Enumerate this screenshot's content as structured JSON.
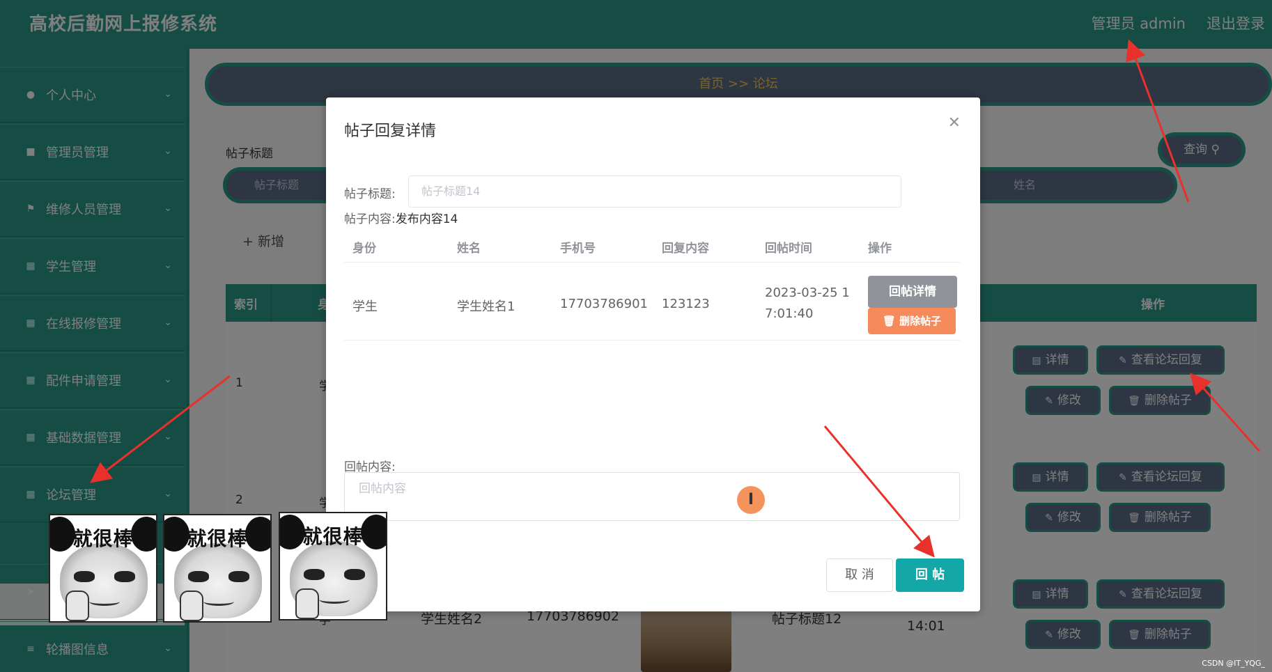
{
  "app": {
    "title": "高校后勤网上报修系统",
    "user_label": "管理员 admin",
    "logout_label": "退出登录"
  },
  "sidebar": {
    "items": [
      {
        "label": "个人中心",
        "icon": "user-icon"
      },
      {
        "label": "管理员管理",
        "icon": "chat-icon"
      },
      {
        "label": "维修人员管理",
        "icon": "flag-icon"
      },
      {
        "label": "学生管理",
        "icon": "grid-icon"
      },
      {
        "label": "在线报修管理",
        "icon": "grid-icon"
      },
      {
        "label": "配件申请管理",
        "icon": "grid-icon"
      },
      {
        "label": "基础数据管理",
        "icon": "grid-icon"
      },
      {
        "label": "论坛管理",
        "icon": "grid-icon"
      },
      {
        "label": "",
        "icon": "send-icon"
      },
      {
        "label": "轮播图信息",
        "icon": "list-icon"
      }
    ]
  },
  "main": {
    "breadcrumb": "首页  >>  论坛",
    "filter_label": "帖子标题",
    "filter_placeholder": "帖子标题",
    "filter_placeholder_right": "姓名",
    "query_label": "查询",
    "add_label": "新增",
    "table_headers": {
      "index": "索引",
      "cut": "身",
      "ops": "操作"
    },
    "rows": [
      {
        "index": "1",
        "cut": "学"
      },
      {
        "index": "2",
        "cut": "学"
      },
      {
        "index": "",
        "cut": "学"
      }
    ],
    "row3": {
      "name": "学生姓名2",
      "phone": "17703786902",
      "post_title": "帖子标题12",
      "time": "14:01"
    },
    "ops": {
      "detail": "详情",
      "view_reply": "查看论坛回复",
      "edit": "修改",
      "delete": "删除帖子"
    }
  },
  "dialog": {
    "title": "帖子回复详情",
    "post_title_label": "帖子标题:",
    "post_title_value": "帖子标题14",
    "post_content_label": "帖子内容:",
    "post_content_value": "发布内容14",
    "columns": [
      "身份",
      "姓名",
      "手机号",
      "回复内容",
      "回帖时间",
      "操作"
    ],
    "reply": {
      "role": "学生",
      "name": "学生姓名1",
      "phone": "17703786901",
      "content": "123123",
      "time_line1": "2023-03-25 1",
      "time_line2": "7:01:40",
      "detail_btn": "回帖详情",
      "delete_btn": "删除帖子"
    },
    "reply_content_label": "回帖内容:",
    "reply_content_placeholder": "回帖内容",
    "cancel_label": "取 消",
    "submit_label": "回 帖"
  },
  "stickers": [
    {
      "caption": "就很棒"
    },
    {
      "caption": "就很棒"
    },
    {
      "caption": "就很棒"
    }
  ],
  "watermark": "CSDN @IT_YQG_",
  "colors": {
    "teal": "#2a9b88",
    "slate": "#5d6c87",
    "submit": "#14a7a7",
    "danger": "#f78a5b",
    "arrow": "#e8312a"
  }
}
